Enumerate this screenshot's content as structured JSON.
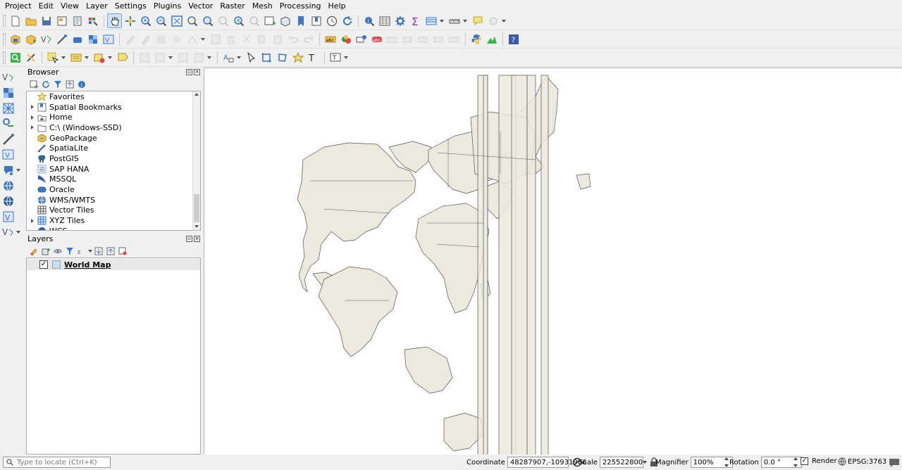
{
  "menu": [
    "Project",
    "Edit",
    "View",
    "Layer",
    "Settings",
    "Plugins",
    "Vector",
    "Raster",
    "Mesh",
    "Processing",
    "Help"
  ],
  "browser": {
    "title": "Browser",
    "items": [
      {
        "label": "Favorites",
        "icon": "star-icon",
        "expandable": false
      },
      {
        "label": "Spatial Bookmarks",
        "icon": "bookmark-icon",
        "expandable": true
      },
      {
        "label": "Home",
        "icon": "home-folder-icon",
        "expandable": true
      },
      {
        "label": "C:\\ (Windows-SSD)",
        "icon": "drive-folder-icon",
        "expandable": true
      },
      {
        "label": "GeoPackage",
        "icon": "geopackage-icon",
        "expandable": false
      },
      {
        "label": "SpatiaLite",
        "icon": "spatialite-icon",
        "expandable": false
      },
      {
        "label": "PostGIS",
        "icon": "postgis-elephant-icon",
        "expandable": false
      },
      {
        "label": "SAP HANA",
        "icon": "sap-hana-icon",
        "expandable": false
      },
      {
        "label": "MSSQL",
        "icon": "mssql-icon",
        "expandable": false
      },
      {
        "label": "Oracle",
        "icon": "oracle-icon",
        "expandable": false
      },
      {
        "label": "WMS/WMTS",
        "icon": "wms-globe-icon",
        "expandable": false
      },
      {
        "label": "Vector Tiles",
        "icon": "vector-tiles-icon",
        "expandable": false
      },
      {
        "label": "XYZ Tiles",
        "icon": "xyz-tiles-icon",
        "expandable": true
      },
      {
        "label": "WCS",
        "icon": "wcs-globe-icon",
        "expandable": false
      }
    ]
  },
  "layers": {
    "title": "Layers",
    "items": [
      {
        "label": "World Map",
        "checked": "✓"
      }
    ]
  },
  "status": {
    "locate_placeholder": "Type to locate (Ctrl+K)",
    "coordinate_label": "Coordinate",
    "coordinate_value": "48287907,-10931906",
    "scale_label": "Scale",
    "scale_value": "225522800",
    "magnifier_label": "Magnifier",
    "magnifier_value": "100%",
    "rotation_label": "Rotation",
    "rotation_value": "0.0 °",
    "render_label": "Render",
    "render_checked": "✓",
    "crs_label": "EPSG:3763"
  },
  "colors": {
    "land_fill": "#ece9df",
    "land_stroke": "#555555",
    "accent": "#3b77c4"
  }
}
